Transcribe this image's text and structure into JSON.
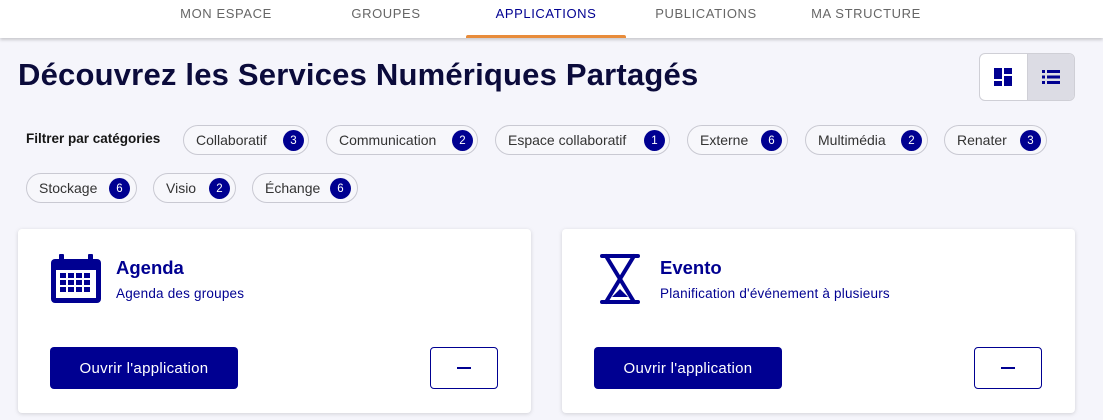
{
  "nav": {
    "items": [
      {
        "label": "MON ESPACE"
      },
      {
        "label": "GROUPES"
      },
      {
        "label": "APPLICATIONS"
      },
      {
        "label": "PUBLICATIONS"
      },
      {
        "label": "MA STRUCTURE"
      }
    ],
    "active": "APPLICATIONS"
  },
  "page": {
    "title": "Découvrez les Services Numériques Partagés"
  },
  "view_toggle": {
    "options": [
      "grid-icon",
      "list-icon"
    ],
    "selected": "list-icon"
  },
  "filters": {
    "label": "Filtrer par catégories",
    "categories": [
      {
        "name": "Collaboratif",
        "count": "3"
      },
      {
        "name": "Communication",
        "count": "2"
      },
      {
        "name": "Espace collaboratif",
        "count": "1"
      },
      {
        "name": "Externe",
        "count": "6"
      },
      {
        "name": "Multimédia",
        "count": "2"
      },
      {
        "name": "Renater",
        "count": "3"
      },
      {
        "name": "Stockage",
        "count": "6"
      },
      {
        "name": "Visio",
        "count": "2"
      },
      {
        "name": "Échange",
        "count": "6"
      }
    ]
  },
  "cards": [
    {
      "icon": "calendar-icon",
      "title": "Agenda",
      "description": "Agenda des groupes",
      "open_label": "Ouvrir l'application",
      "remove_icon": "minus-icon"
    },
    {
      "icon": "hourglass-icon",
      "title": "Evento",
      "description": "Planification d'événement à plusieurs",
      "open_label": "Ouvrir l'application",
      "remove_icon": "minus-icon"
    }
  ],
  "colors": {
    "primary": "#000091",
    "active_underline": "#e88c3a",
    "background": "#f5f5fb"
  }
}
